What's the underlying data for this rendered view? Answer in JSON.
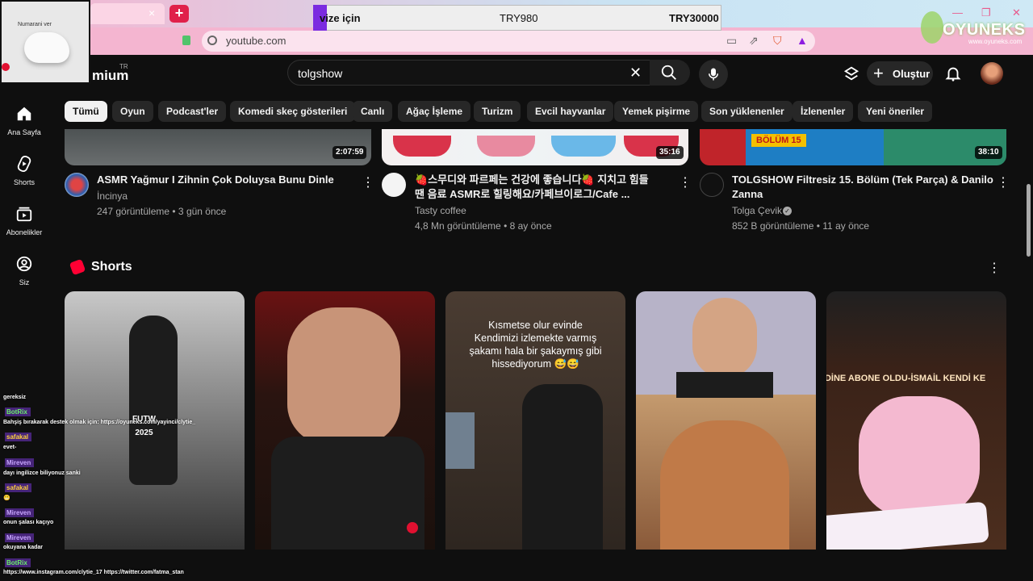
{
  "browser": {
    "url": "youtube.com",
    "tab_close": "×",
    "new_tab": "+",
    "window_controls": [
      "—",
      "❐",
      "✕"
    ]
  },
  "price_overlay": {
    "label": "vize için",
    "mid_price": "TRY980",
    "right_price": "TRY30000"
  },
  "brand": {
    "name": "OYUNEKS",
    "sub": "www.oyuneks.com"
  },
  "webcam": {
    "label": "Numarani ver"
  },
  "header": {
    "logo_text": "mium",
    "logo_country": "TR",
    "search_value": "tolgshow",
    "create_label": "Oluştur"
  },
  "sidebar": [
    {
      "label": "Ana Sayfa",
      "icon": "home-icon"
    },
    {
      "label": "Shorts",
      "icon": "shorts-icon"
    },
    {
      "label": "Abonelikler",
      "icon": "subscriptions-icon"
    },
    {
      "label": "Siz",
      "icon": "you-icon"
    }
  ],
  "chips": [
    "Tümü",
    "Oyun",
    "Podcast'ler",
    "Komedi skeç gösterileri",
    "Canlı",
    "Ağaç İşleme",
    "Turizm",
    "Evcil hayvanlar",
    "Yemek pişirme",
    "Son yüklenenler",
    "İzlenenler",
    "Yeni öneriler"
  ],
  "videos": [
    {
      "title": "ASMR Yağmur I Zihnin Çok Doluysa Bunu Dinle",
      "title_line2": "",
      "channel": "İncinya",
      "meta": "247 görüntüleme • 3 gün önce",
      "duration": "2:07:59",
      "thumb_color": "#5a5e5f"
    },
    {
      "title": "🍓스무디와 파르페는 건강에 좋습니다🍓 지치고 힘들",
      "title_line2": "땐 음료 ASMR로 힐링해요/카페브이로그/Cafe ...",
      "channel": "Tasty coffee",
      "meta": "4,8 Mn görüntüleme • 8 ay önce",
      "duration": "35:16",
      "thumb_color": "#f3eeee"
    },
    {
      "title": "TOLGSHOW Filtresiz 15. Bölüm (Tek Parça) & Danilo",
      "title_line2": "Zanna",
      "channel": "Tolga Çevik",
      "meta": "852 B görüntüleme • 11 ay önce",
      "duration": "38:10",
      "thumb_badge": "BÖLÜM 15",
      "thumb_color": "#1f6fb0"
    }
  ],
  "shorts_section": {
    "title": "Shorts",
    "items": [
      {
        "overlay": "FUTW\n2025",
        "bg": "#3c3c3c"
      },
      {
        "overlay": "",
        "bg": "#2a1410"
      },
      {
        "overlay": "Kısmetse olur evinde\nKendimizi izlemekte varmış\nşakamı hala bir şakaymış gibi\nhissediyorum 😅😅",
        "bg": "#3a302a"
      },
      {
        "overlay": "",
        "bg": "#5b4a3e"
      },
      {
        "overlay": "NDİNE ABONE OLDU-İSMAİL KENDİ KE",
        "bg": "#3a2218"
      }
    ]
  },
  "chat": {
    "messages": [
      {
        "type": "text",
        "text": "gereksiz"
      },
      {
        "type": "user",
        "user": "BotRix",
        "color": "green"
      },
      {
        "type": "text",
        "text": "Bahşiş bırakarak destek olmak için: https://oyuneks.com/yayinci/clytie_"
      },
      {
        "type": "user",
        "user": "safakal",
        "color": "yellow"
      },
      {
        "type": "text",
        "text": "evet-"
      },
      {
        "type": "user",
        "user": "Mireven",
        "color": "purple"
      },
      {
        "type": "text",
        "text": "dayı ingilizce biliyonuz sanki"
      },
      {
        "type": "user",
        "user": "safakal",
        "color": "yellow"
      },
      {
        "type": "text",
        "text": "😬"
      },
      {
        "type": "user",
        "user": "Mireven",
        "color": "purple"
      },
      {
        "type": "text",
        "text": "onun şalası kaçıyo"
      },
      {
        "type": "user",
        "user": "Mireven",
        "color": "purple"
      },
      {
        "type": "text",
        "text": "okuyana kadar"
      },
      {
        "type": "user",
        "user": "BotRix",
        "color": "green"
      },
      {
        "type": "text",
        "text": "https://www.instagram.com/clytie_17 https://twitter.com/fatma_stan"
      }
    ]
  },
  "colors": {
    "yt_bg": "#0f0f0f",
    "chip_bg": "#272727",
    "yt_red": "#ff0033",
    "chrome_pink": "#f3a6c8"
  }
}
